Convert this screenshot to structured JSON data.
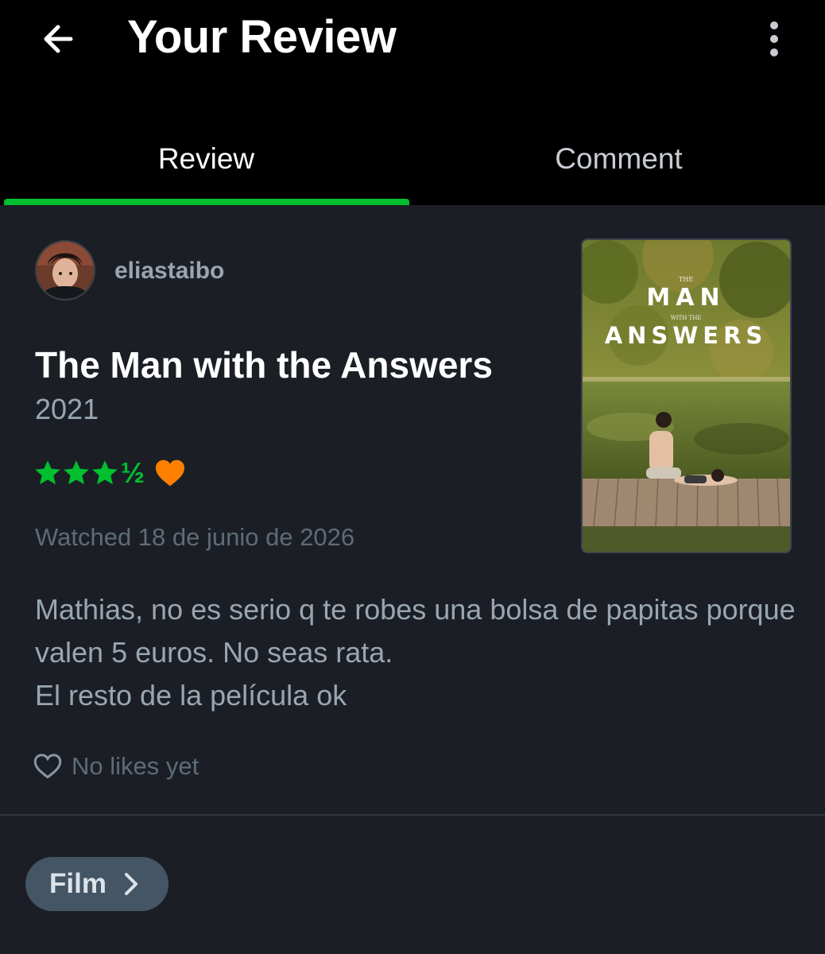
{
  "header": {
    "title": "Your Review",
    "back_icon": "arrow-left-icon",
    "more_icon": "more-vertical-icon"
  },
  "tabs": [
    {
      "label": "Review",
      "active": true
    },
    {
      "label": "Comment",
      "active": false
    }
  ],
  "review": {
    "username": "eliastaibo",
    "film_title": "The Man with the Answers",
    "year": "2021",
    "rating": {
      "stars": 3.5,
      "full_stars": 3,
      "half_symbol": "½",
      "liked": true
    },
    "watched": "Watched 18 de junio de 2026",
    "text": [
      "Mathias, no es serio q te robes una bolsa de papitas porque valen 5 euros. No seas rata.",
      "El resto de la película ok"
    ],
    "likes_text": "No likes yet"
  },
  "poster": {
    "title_small_1": "THE",
    "title_big_1": "MAN",
    "title_small_2": "WITH THE",
    "title_big_2": "ANSWERS"
  },
  "footer": {
    "chip_label": "Film"
  },
  "colors": {
    "accent_green": "#00c030",
    "like_orange": "#ff8000",
    "background": "#1b1f25",
    "header": "#000000",
    "muted_text": "#9aa5b1"
  }
}
